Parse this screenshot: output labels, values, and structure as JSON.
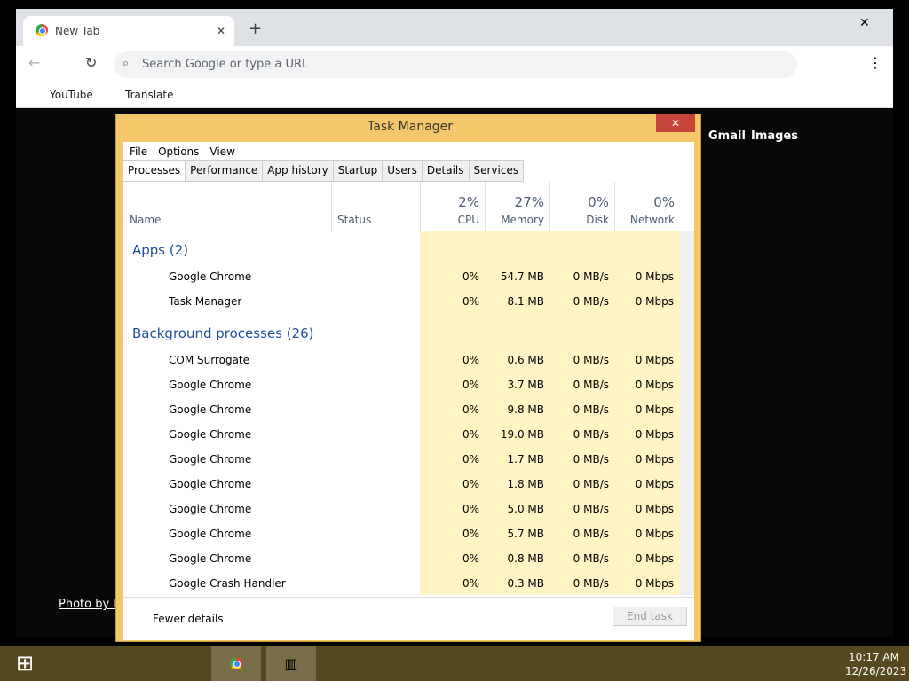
{
  "browser": {
    "tab_title": "New Tab",
    "omnibox_placeholder": "Search Google or type a URL",
    "bookmarks": [
      "YouTube",
      "Translate"
    ],
    "ntp_links": [
      "Gmail",
      "Images"
    ],
    "photo_credit": "Photo by N"
  },
  "taskmgr": {
    "title": "Task Manager",
    "menus": [
      "File",
      "Options",
      "View"
    ],
    "tabs": [
      "Processes",
      "Performance",
      "App history",
      "Startup",
      "Users",
      "Details",
      "Services"
    ],
    "cols": {
      "name": "Name",
      "status": "Status",
      "cpu_pct": "2%",
      "cpu": "CPU",
      "mem_pct": "27%",
      "mem": "Memory",
      "disk_pct": "0%",
      "disk": "Disk",
      "net_pct": "0%",
      "net": "Network"
    },
    "apps_header": "Apps (2)",
    "bg_header": "Background processes (26)",
    "apps": [
      {
        "name": "Google Chrome",
        "cpu": "0%",
        "mem": "54.7 MB",
        "disk": "0 MB/s",
        "net": "0 Mbps"
      },
      {
        "name": "Task Manager",
        "cpu": "0%",
        "mem": "8.1 MB",
        "disk": "0 MB/s",
        "net": "0 Mbps"
      }
    ],
    "bg": [
      {
        "name": "COM Surrogate",
        "cpu": "0%",
        "mem": "0.6 MB",
        "disk": "0 MB/s",
        "net": "0 Mbps"
      },
      {
        "name": "Google Chrome",
        "cpu": "0%",
        "mem": "3.7 MB",
        "disk": "0 MB/s",
        "net": "0 Mbps"
      },
      {
        "name": "Google Chrome",
        "cpu": "0%",
        "mem": "9.8 MB",
        "disk": "0 MB/s",
        "net": "0 Mbps"
      },
      {
        "name": "Google Chrome",
        "cpu": "0%",
        "mem": "19.0 MB",
        "disk": "0 MB/s",
        "net": "0 Mbps"
      },
      {
        "name": "Google Chrome",
        "cpu": "0%",
        "mem": "1.7 MB",
        "disk": "0 MB/s",
        "net": "0 Mbps"
      },
      {
        "name": "Google Chrome",
        "cpu": "0%",
        "mem": "1.8 MB",
        "disk": "0 MB/s",
        "net": "0 Mbps"
      },
      {
        "name": "Google Chrome",
        "cpu": "0%",
        "mem": "5.0 MB",
        "disk": "0 MB/s",
        "net": "0 Mbps"
      },
      {
        "name": "Google Chrome",
        "cpu": "0%",
        "mem": "5.7 MB",
        "disk": "0 MB/s",
        "net": "0 Mbps"
      },
      {
        "name": "Google Chrome",
        "cpu": "0%",
        "mem": "0.8 MB",
        "disk": "0 MB/s",
        "net": "0 Mbps"
      },
      {
        "name": "Google Crash Handler",
        "cpu": "0%",
        "mem": "0.3 MB",
        "disk": "0 MB/s",
        "net": "0 Mbps"
      }
    ],
    "fewer": "Fewer details",
    "end": "End task"
  },
  "clock": {
    "time": "10:17 AM",
    "date": "12/26/2023"
  }
}
